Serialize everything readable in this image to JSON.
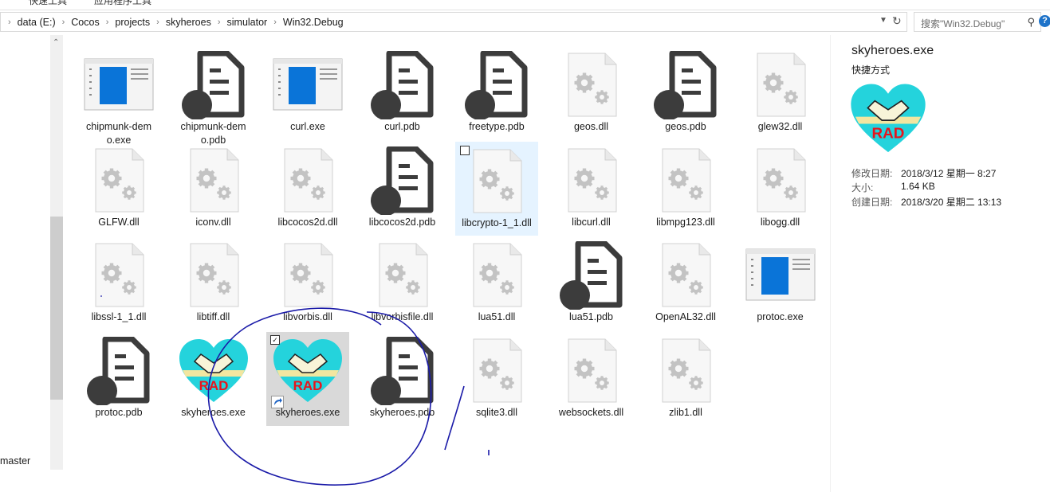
{
  "tabs": [
    "快速工具",
    "应用程序工具"
  ],
  "address": {
    "crumbs": [
      "data (E:)",
      "Cocos",
      "projects",
      "skyheroes",
      "simulator",
      "Win32.Debug"
    ]
  },
  "search": {
    "placeholder": "搜索\"Win32.Debug\""
  },
  "help": "?",
  "nav": {
    "label": "master"
  },
  "files": [
    {
      "name": "chipmunk-demo.exe",
      "type": "window"
    },
    {
      "name": "chipmunk-demo.pdb",
      "type": "pdb"
    },
    {
      "name": "curl.exe",
      "type": "window"
    },
    {
      "name": "curl.pdb",
      "type": "pdb"
    },
    {
      "name": "freetype.pdb",
      "type": "pdb"
    },
    {
      "name": "geos.dll",
      "type": "dll"
    },
    {
      "name": "geos.pdb",
      "type": "pdb"
    },
    {
      "name": "glew32.dll",
      "type": "dll"
    },
    {
      "name": "GLFW.dll",
      "type": "dll"
    },
    {
      "name": "iconv.dll",
      "type": "dll"
    },
    {
      "name": "libcocos2d.dll",
      "type": "dll"
    },
    {
      "name": "libcocos2d.pdb",
      "type": "pdb"
    },
    {
      "name": "libcrypto-1_1.dll",
      "type": "dll",
      "state": "hover"
    },
    {
      "name": "libcurl.dll",
      "type": "dll"
    },
    {
      "name": "libmpg123.dll",
      "type": "dll"
    },
    {
      "name": "libogg.dll",
      "type": "dll"
    },
    {
      "name": "libssl-1_1.dll",
      "type": "dll"
    },
    {
      "name": "libtiff.dll",
      "type": "dll"
    },
    {
      "name": "libvorbis.dll",
      "type": "dll"
    },
    {
      "name": "libvorbisfile.dll",
      "type": "dll"
    },
    {
      "name": "lua51.dll",
      "type": "dll"
    },
    {
      "name": "lua51.pdb",
      "type": "pdb"
    },
    {
      "name": "OpenAL32.dll",
      "type": "dll"
    },
    {
      "name": "protoc.exe",
      "type": "window"
    },
    {
      "name": "protoc.pdb",
      "type": "pdb"
    },
    {
      "name": "skyheroes.exe",
      "type": "rad"
    },
    {
      "name": "skyheroes.exe",
      "type": "rad",
      "state": "selected",
      "shortcut": true
    },
    {
      "name": "skyheroes.pdb",
      "type": "pdb"
    },
    {
      "name": "sqlite3.dll",
      "type": "dll"
    },
    {
      "name": "websockets.dll",
      "type": "dll"
    },
    {
      "name": "zlib1.dll",
      "type": "dll"
    }
  ],
  "details": {
    "title": "skyheroes.exe",
    "type": "快捷方式",
    "modified_label": "修改日期:",
    "modified_value": "2018/3/12 星期一 8:27",
    "size_label": "大小:",
    "size_value": "1.64 KB",
    "created_label": "创建日期:",
    "created_value": "2018/3/20 星期二 13:13"
  },
  "rad_text": "RAD",
  "colors": {
    "rad_heart": "#24d3dc",
    "rad_text": "#e8141c",
    "pdb_dark": "#3c3c3c",
    "annotation": "#1a1aa8",
    "hover": "#e5f3ff",
    "selected": "#d9d9d9"
  }
}
